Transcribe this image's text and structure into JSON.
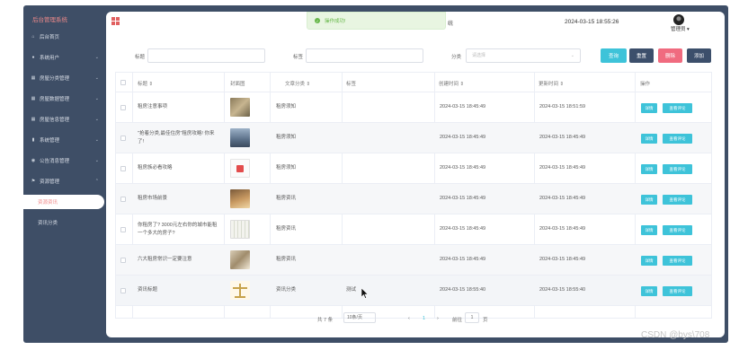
{
  "app": {
    "brand": "后台管理系统"
  },
  "sidebar": {
    "items": [
      {
        "label": "后台首页",
        "icon": "home-icon",
        "chev": ""
      },
      {
        "label": "系统用户",
        "icon": "user-icon",
        "chev": "⌄"
      },
      {
        "label": "房屋分类管理",
        "icon": "grid-icon",
        "chev": "⌄"
      },
      {
        "label": "房屋数据管理",
        "icon": "grid-icon",
        "chev": "⌄"
      },
      {
        "label": "房屋信息管理",
        "icon": "grid-icon",
        "chev": "⌄"
      },
      {
        "label": "系统管理",
        "icon": "chart-icon",
        "chev": "⌄"
      },
      {
        "label": "公告消息管理",
        "icon": "info-icon",
        "chev": "⌄"
      },
      {
        "label": "资源管理",
        "icon": "flag-icon",
        "chev": "⌃"
      }
    ],
    "subitems": [
      {
        "label": "资源资讯",
        "active": true
      },
      {
        "label": "资讯分类",
        "active": false
      }
    ]
  },
  "header": {
    "toast": "操作成功!",
    "title_fragment": "统",
    "datetime": "2024-03-15 18:55:26",
    "user": "管理员 ▾"
  },
  "search": {
    "field1_label": "标题",
    "field2_label": "标签",
    "category_label": "分类",
    "category_placeholder": "请选择",
    "buttons": {
      "query": "查询",
      "reset": "重置",
      "delete": "删除",
      "add": "添加"
    }
  },
  "table": {
    "headers": [
      "标题 ⇕",
      "封面图",
      "文章分类 ⇕",
      "标签",
      "创建时间 ⇕",
      "更新时间 ⇕",
      "操作"
    ],
    "rows": [
      {
        "title": "租房注意事项",
        "category": "租房须知",
        "tag": "",
        "created": "2024-03-15 18:45:49",
        "updated": "2024-03-15 18:51:59",
        "thumb": "stone"
      },
      {
        "title": "\"抢着分类,最佳住房\"租房攻略! 你来了!",
        "category": "租房须知",
        "tag": "",
        "created": "2024-03-15 18:45:49",
        "updated": "2024-03-15 18:45:49",
        "thumb": "city"
      },
      {
        "title": "租房族必看攻略",
        "category": "租房须知",
        "tag": "",
        "created": "2024-03-15 18:45:49",
        "updated": "2024-03-15 18:45:49",
        "thumb": "card"
      },
      {
        "title": "租房市场前景",
        "category": "租房资讯",
        "tag": "",
        "created": "2024-03-15 18:45:49",
        "updated": "2024-03-15 18:45:49",
        "thumb": "bed"
      },
      {
        "title": "你租房了? 3000元左右你的城市能租一个多大的房子?",
        "category": "租房资讯",
        "tag": "",
        "created": "2024-03-15 18:45:49",
        "updated": "2024-03-15 18:45:49",
        "thumb": "plan"
      },
      {
        "title": "六大租房常识一定要注意",
        "category": "租房资讯",
        "tag": "",
        "created": "2024-03-15 18:45:49",
        "updated": "2024-03-15 18:45:49",
        "thumb": "room"
      },
      {
        "title": "资讯标题",
        "category": "资讯分类",
        "tag": "测试",
        "created": "2024-03-15 18:55:40",
        "updated": "2024-03-15 18:55:40",
        "thumb": "scale"
      }
    ],
    "actions": {
      "detail": "详情",
      "comments": "查看评论"
    }
  },
  "pagination": {
    "total": "共 7 条",
    "page_size": "10条/页",
    "prev": "‹",
    "current": "1",
    "next": "›",
    "goto_prefix": "前往",
    "goto_value": "1",
    "goto_suffix": "页"
  },
  "watermark": "CSDN @bys\\708",
  "colors": {
    "sidebar_bg": "#3e4e66",
    "accent_pink": "#f08a8a",
    "query_btn": "#3ec3d9",
    "reset_btn": "#3c4f6b",
    "delete_btn": "#f06b7f",
    "add_btn": "#3c4f6b",
    "toast_text": "#67b84a"
  }
}
